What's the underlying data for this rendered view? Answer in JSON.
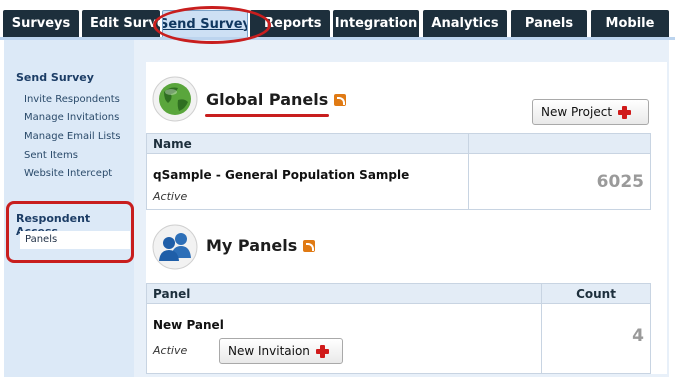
{
  "nav": {
    "tabs": [
      {
        "label": "Surveys"
      },
      {
        "label": "Edit Survey"
      },
      {
        "label": "Send Survey"
      },
      {
        "label": "Reports"
      },
      {
        "label": "Integration"
      },
      {
        "label": "Analytics"
      },
      {
        "label": "Panels"
      },
      {
        "label": "Mobile"
      }
    ],
    "active": "Send Survey"
  },
  "sidebar": {
    "send_survey_title": "Send Survey",
    "items": [
      {
        "label": "Invite Respondents"
      },
      {
        "label": "Manage Invitations"
      },
      {
        "label": "Manage Email Lists"
      },
      {
        "label": "Sent Items"
      },
      {
        "label": "Website Intercept"
      }
    ],
    "respondent_title": "Respondent Access",
    "respondent_items": [
      {
        "label": "Panels",
        "selected": true
      }
    ]
  },
  "global_panels": {
    "title": "Global Panels",
    "new_project_label": "New Project",
    "columns": [
      "Name",
      ""
    ],
    "rows": [
      {
        "name": "qSample - General Population Sample",
        "status": "Active",
        "count": "6025"
      }
    ]
  },
  "my_panels": {
    "title": "My Panels",
    "columns": [
      "Panel",
      "Count"
    ],
    "rows": [
      {
        "name": "New Panel",
        "status": "Active",
        "button_label": "New Invitaion",
        "count": "4"
      }
    ]
  },
  "colors": {
    "tab_bg": "#1d2f3c",
    "tab_active_bg": "#cde0f4",
    "sidebar_bg": "#dce9f7",
    "annotation_red": "#c81e1e",
    "rss_orange": "#e07a14",
    "add_red": "#d01a1a"
  },
  "icons": [
    "globe-icon",
    "people-icon",
    "rss-icon",
    "add-icon"
  ]
}
